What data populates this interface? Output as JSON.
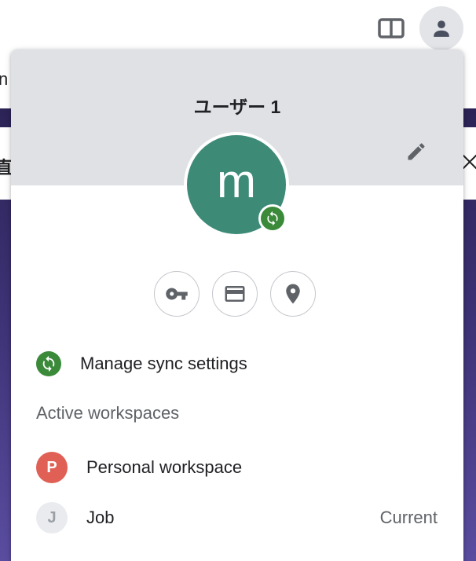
{
  "background": {
    "fragment_left_top": "n",
    "fragment_left_mid": "直"
  },
  "profile": {
    "name": "ユーザー 1",
    "avatar_letter": "m",
    "avatar_color": "#3d8b77",
    "sync_badge_color": "#3a8a3a"
  },
  "toolbar": {
    "split_view_icon": "split-view-icon",
    "profile_icon": "person-icon"
  },
  "quick_actions": [
    {
      "icon": "key-icon"
    },
    {
      "icon": "credit-card-icon"
    },
    {
      "icon": "location-pin-icon"
    }
  ],
  "sync": {
    "label": "Manage sync settings"
  },
  "workspaces": {
    "title": "Active workspaces",
    "items": [
      {
        "initial": "P",
        "label": "Personal workspace",
        "status": "",
        "color": "#e06055"
      },
      {
        "initial": "J",
        "label": "Job",
        "status": "Current",
        "color": "#eaebee"
      }
    ]
  }
}
